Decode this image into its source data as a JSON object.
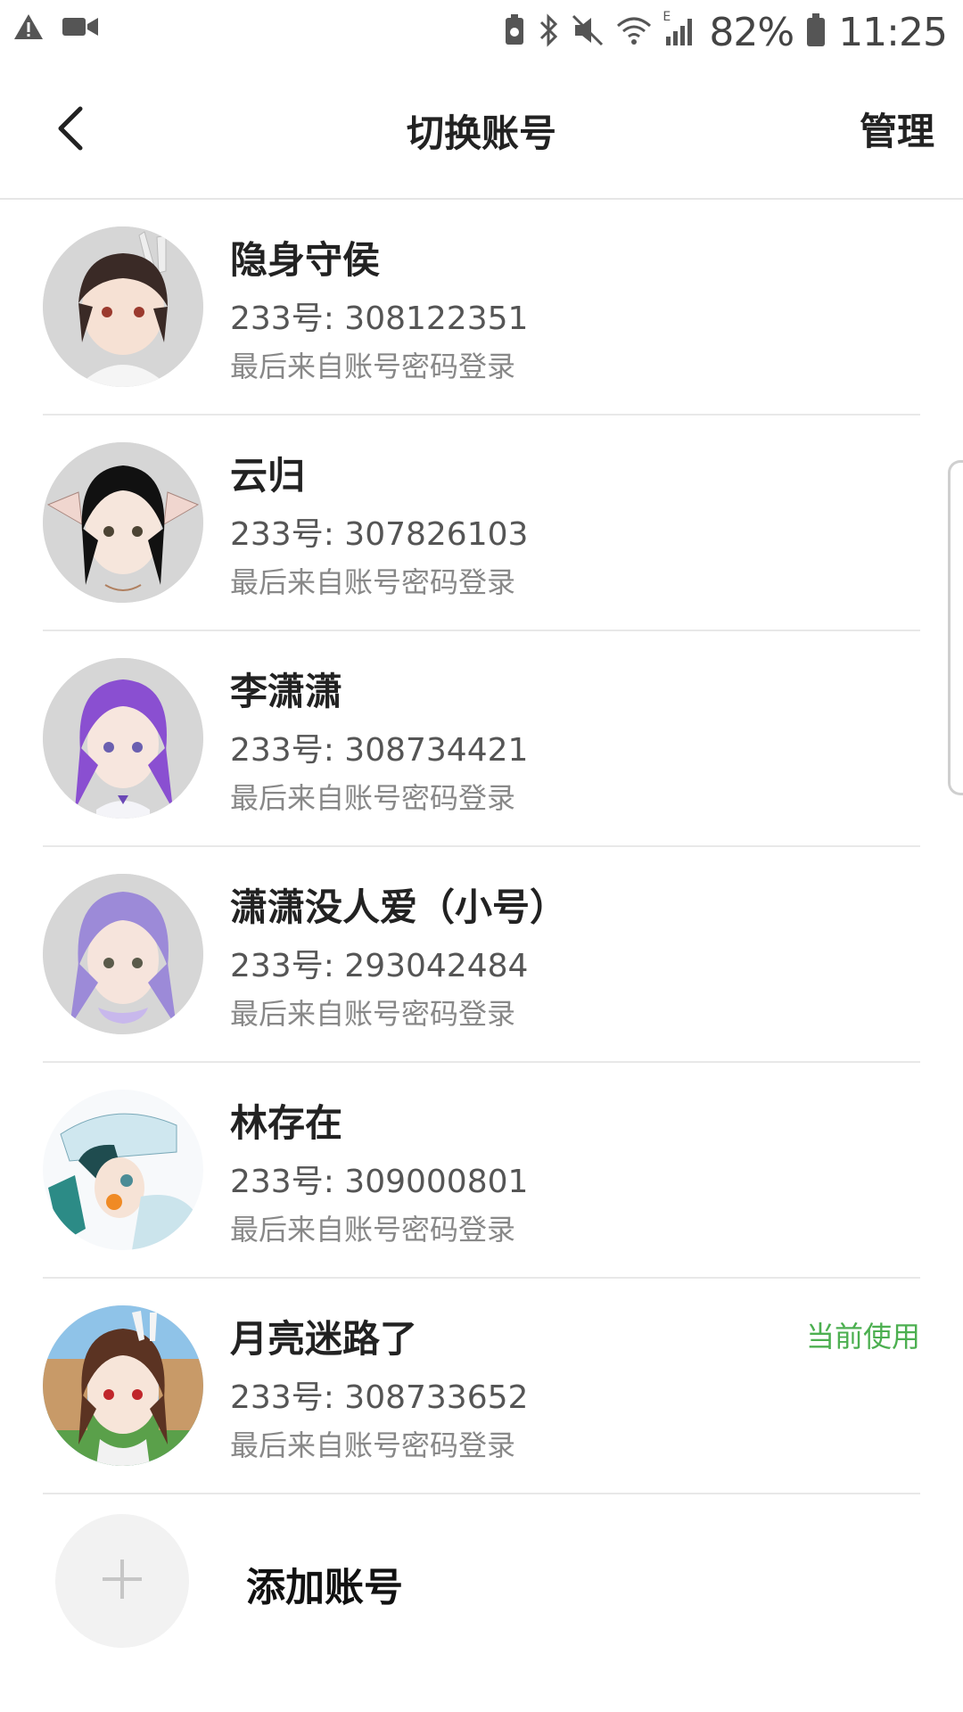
{
  "status_bar": {
    "battery_percent": "82%",
    "time": "11:25",
    "network_label": "E",
    "icons_left": [
      "warning-icon",
      "video-icon"
    ],
    "icons_right": [
      "battery-saver-icon",
      "bluetooth-icon",
      "mute-icon",
      "wifi-icon",
      "signal-icon",
      "battery-icon"
    ]
  },
  "header": {
    "title": "切换账号",
    "manage_label": "管理",
    "back_icon": "chevron-left-icon"
  },
  "accounts": [
    {
      "name": "隐身守侯",
      "uid": "233号: 308122351",
      "login": "最后来自账号密码登录",
      "current": ""
    },
    {
      "name": "云归",
      "uid": "233号: 307826103",
      "login": "最后来自账号密码登录",
      "current": ""
    },
    {
      "name": "李潇潇",
      "uid": "233号: 308734421",
      "login": "最后来自账号密码登录",
      "current": ""
    },
    {
      "name": "潇潇没人爱（小号）",
      "uid": "233号: 293042484",
      "login": "最后来自账号密码登录",
      "current": ""
    },
    {
      "name": "林存在",
      "uid": "233号: 309000801",
      "login": "最后来自账号密码登录",
      "current": ""
    },
    {
      "name": "月亮迷路了",
      "uid": "233号: 308733652",
      "login": "最后来自账号密码登录",
      "current": "当前使用"
    }
  ],
  "add_account": {
    "label": "添加账号",
    "icon": "plus-icon"
  },
  "colors": {
    "current_badge": "#4caf50",
    "divider": "#e8e8e8",
    "avatar_bg": "#d9d9d9"
  }
}
